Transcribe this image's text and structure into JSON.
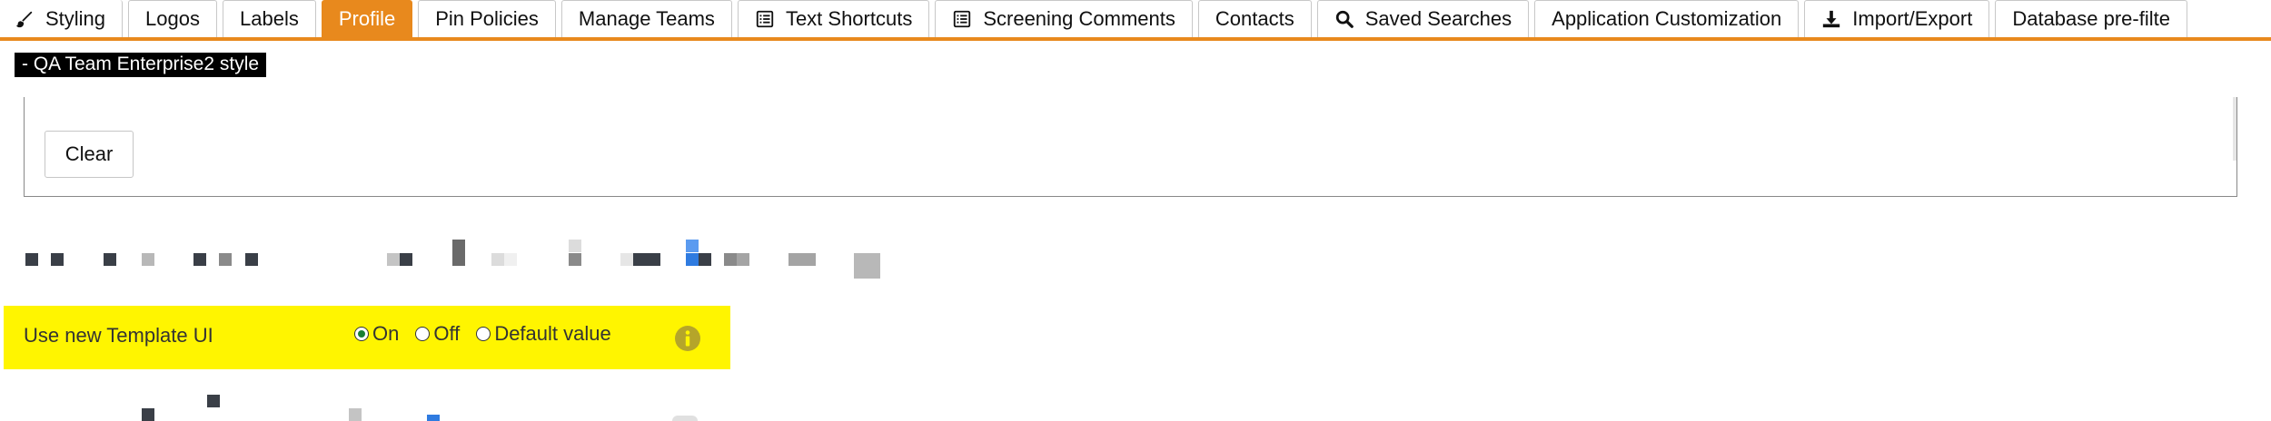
{
  "tabs": [
    {
      "label": "Styling",
      "icon": "brush-icon",
      "active": false
    },
    {
      "label": "Logos",
      "icon": "",
      "active": false
    },
    {
      "label": "Labels",
      "icon": "",
      "active": false
    },
    {
      "label": "Profile",
      "icon": "",
      "active": true
    },
    {
      "label": "Pin Policies",
      "icon": "",
      "active": false
    },
    {
      "label": "Manage Teams",
      "icon": "",
      "active": false
    },
    {
      "label": "Text Shortcuts",
      "icon": "list-icon",
      "active": false
    },
    {
      "label": "Screening Comments",
      "icon": "list-icon",
      "active": false
    },
    {
      "label": "Contacts",
      "icon": "",
      "active": false
    },
    {
      "label": "Saved Searches",
      "icon": "search-icon",
      "active": false
    },
    {
      "label": "Application Customization",
      "icon": "",
      "active": false
    },
    {
      "label": "Import/Export",
      "icon": "download-icon",
      "active": false
    },
    {
      "label": "Database pre-filte",
      "icon": "",
      "active": false
    }
  ],
  "style_badge": "- QA Team Enterprise2 style",
  "panel": {
    "clear_label": "Clear"
  },
  "setting": {
    "label": "Use new Template UI",
    "options": [
      {
        "label": "On",
        "checked": true
      },
      {
        "label": "Off",
        "checked": false
      },
      {
        "label": "Default value",
        "checked": false
      }
    ],
    "info_icon": "info-icon"
  },
  "colors": {
    "accent": "#E8891D",
    "highlight": "#FFF500",
    "info": "#B5A52A",
    "radio_checked": "#1A7F32"
  }
}
